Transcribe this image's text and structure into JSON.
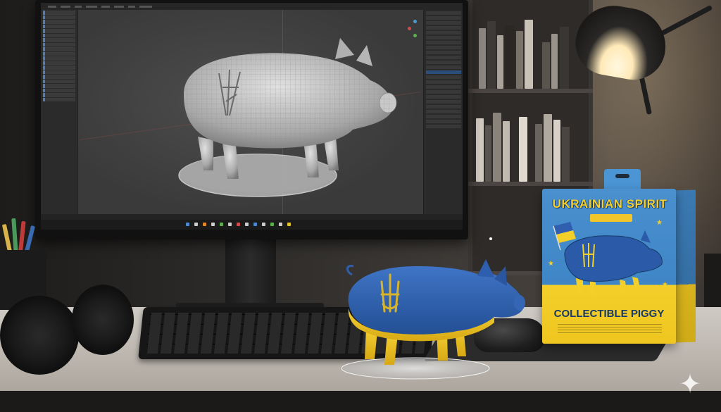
{
  "box": {
    "title": "UKRAINIAN SPIRIT",
    "badge": "",
    "subtitle": "COLLECTIBLE PIGGY",
    "side_text": ""
  },
  "colors": {
    "ukraine_blue": "#2f5fae",
    "ukraine_yellow": "#f0c620",
    "wall": "#3b3835",
    "desk": "#c4beb7",
    "lamp_light": "#fff3d0"
  },
  "icons": {
    "sparkle": "sparkle-icon"
  }
}
